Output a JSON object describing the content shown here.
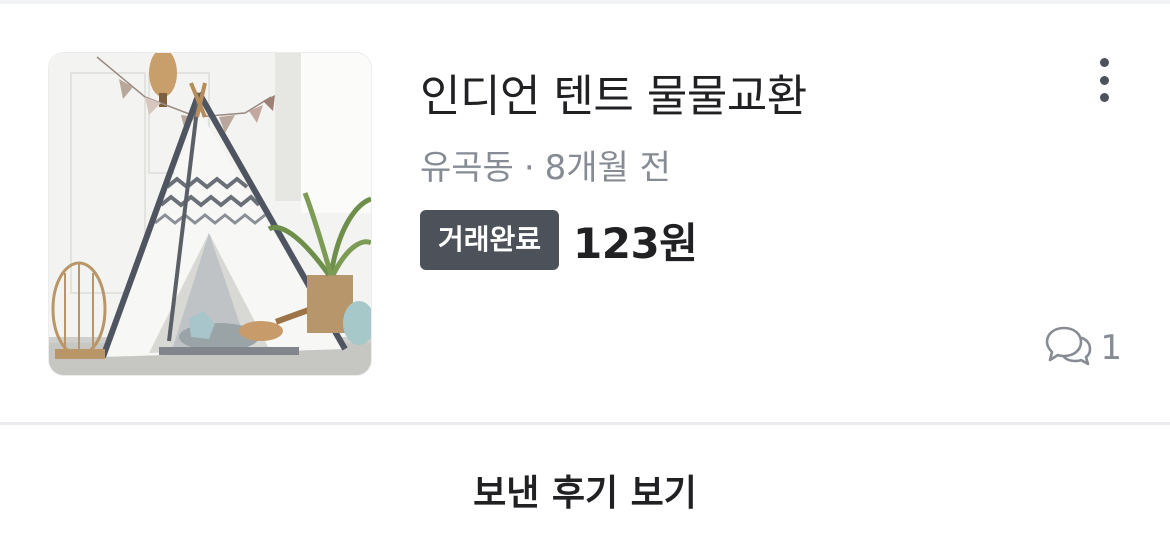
{
  "item": {
    "title": "인디언 텐트 물물교환",
    "location": "유곡동",
    "separator": "·",
    "time_ago": "8개월 전",
    "status_badge": "거래완료",
    "price": "123원",
    "chat_count": "1",
    "thumbnail_icon": "teepee-tent-photo",
    "more_icon": "more-vertical-icon",
    "chat_icon": "chat-bubbles-icon"
  },
  "footer": {
    "review_button_label": "보낸 후기 보기"
  },
  "colors": {
    "title_text": "#212124",
    "meta_text": "#868b94",
    "badge_bg": "#4d5159",
    "badge_text": "#ffffff",
    "divider": "#eaebee"
  }
}
